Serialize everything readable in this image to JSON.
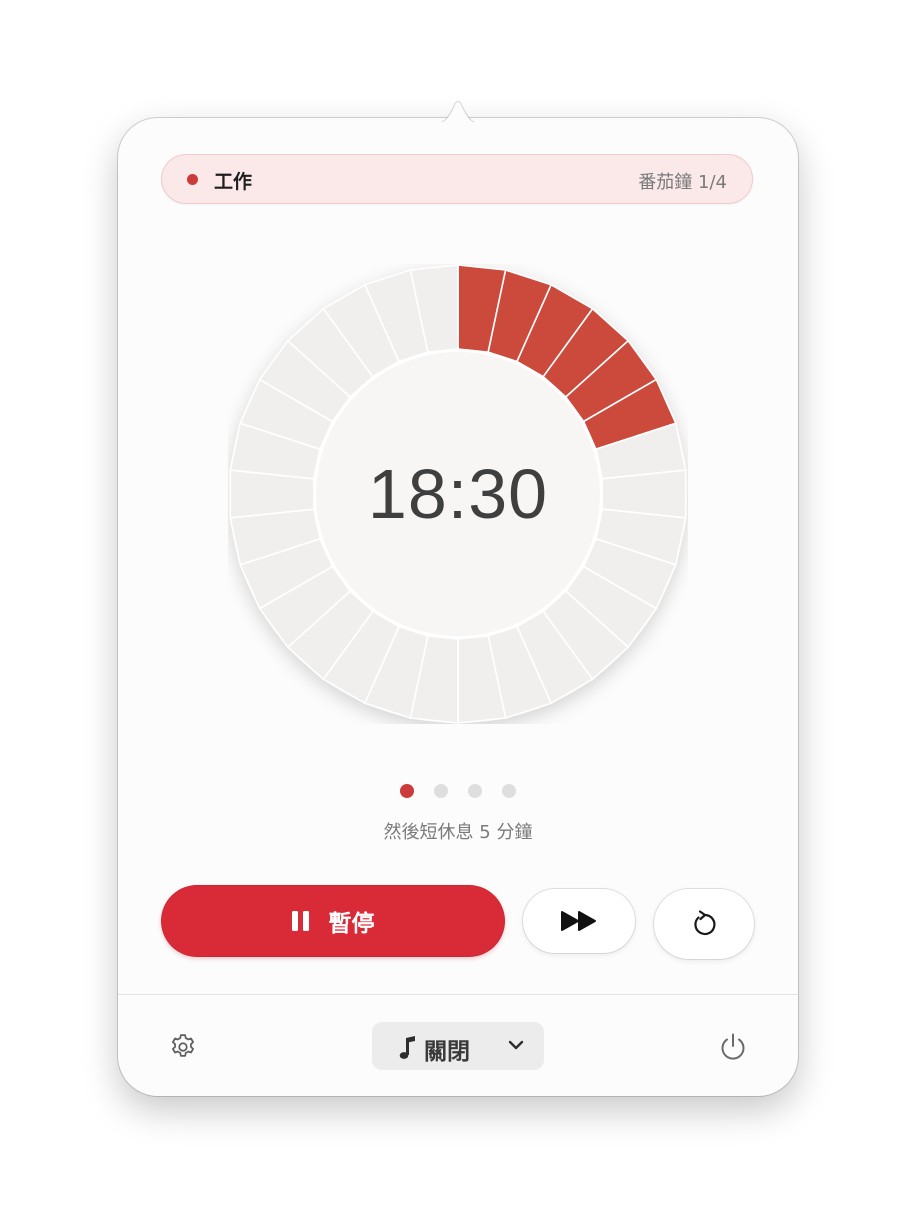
{
  "session": {
    "label": "工作",
    "count": "番茄鐘 1/4"
  },
  "timer": {
    "remaining": "18:30",
    "progress": 0.2,
    "segments": 30,
    "accent": "#cc4a3c",
    "track": "#f1efed"
  },
  "pager": {
    "total": 4,
    "active": 0
  },
  "next_up": "然後短休息 5 分鐘",
  "controls": {
    "pause_label": "暫停",
    "primary_color": "#d92b37"
  },
  "footer": {
    "sound_label": "關閉"
  }
}
